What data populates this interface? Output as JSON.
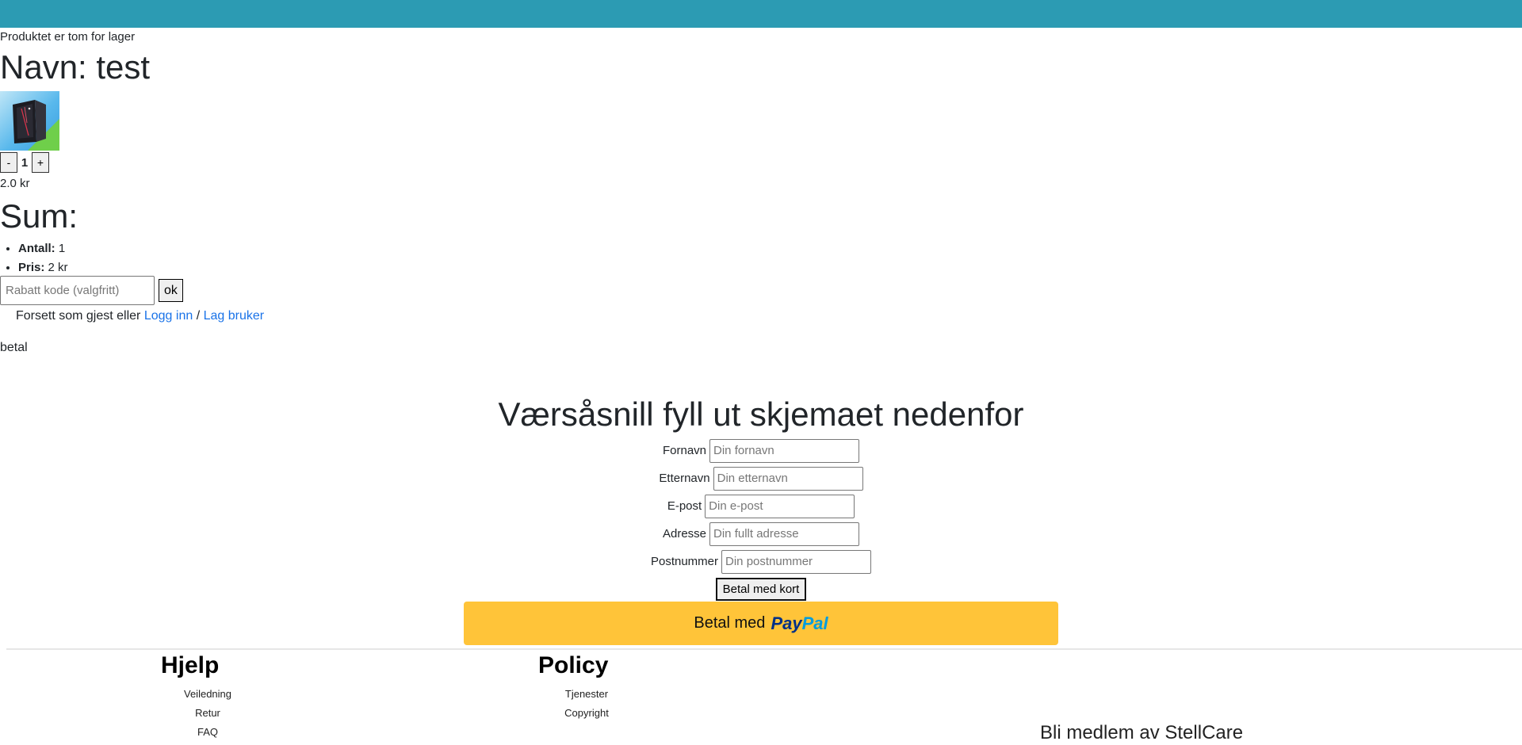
{
  "header": {
    "bar_color": "#2c9bb3"
  },
  "product": {
    "stock_message": "Produktet er tom for lager",
    "name": "Navn: test",
    "image_icon": "pc-case-image",
    "quantity": "1",
    "minus_label": "-",
    "plus_label": "+",
    "unit_price": "2.0 kr"
  },
  "summary": {
    "title": "Sum:",
    "count_label": "Antall:",
    "count_value": "1",
    "price_label": "Pris:",
    "price_value": "2 kr"
  },
  "discount": {
    "placeholder": "Rabatt kode (valgfritt)",
    "value": "",
    "ok_label": "ok"
  },
  "guest": {
    "prefix": "Forsett som gjest eller",
    "login_label": "Logg inn",
    "separator": "/",
    "register_label": "Lag bruker"
  },
  "betal_text": "betal",
  "form": {
    "title": "Værsåsnill fyll ut skjemaet nedenfor",
    "fields": [
      {
        "label": "Fornavn",
        "placeholder": "Din fornavn"
      },
      {
        "label": "Etternavn",
        "placeholder": "Din etternavn"
      },
      {
        "label": "E-post",
        "placeholder": "Din e-post"
      },
      {
        "label": "Adresse",
        "placeholder": "Din fullt adresse"
      },
      {
        "label": "Postnummer",
        "placeholder": "Din postnummer"
      }
    ],
    "card_button": "Betal med kort",
    "paypal_prefix": "Betal med",
    "paypal_logo_pay": "Pay",
    "paypal_logo_pal": "Pal",
    "paypal_color": "#ffc439"
  },
  "footer": {
    "help_title": "Hjelp",
    "help_links": [
      "Veiledning",
      "Retur",
      "FAQ"
    ],
    "policy_title": "Policy",
    "policy_links": [
      "Tjenester",
      "Copyright"
    ],
    "member_title": "Bli medlem av StellCare"
  }
}
